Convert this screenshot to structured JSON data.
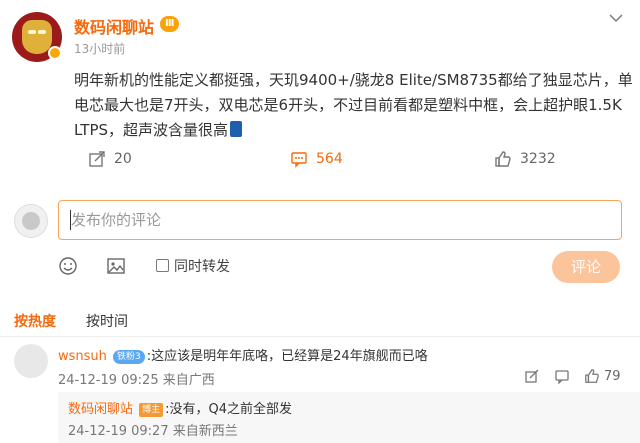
{
  "post": {
    "author": "数码闲聊站",
    "vip_badge": "Ⅲ",
    "time": "13小时前",
    "text": "明年新机的性能定义都挺强，天玑9400+/骁龙8 Elite/SM8735都给了独显芯片，单电芯最大也是7开头，双电芯是6开头，不过目前看都是塑料中框，会上超护眼1.5K LTPS，超声波含量很高",
    "reposts": "20",
    "comments": "564",
    "likes": "3232"
  },
  "composer": {
    "placeholder": "发布你的评论",
    "repost_label": "同时转发",
    "submit_label": "评论"
  },
  "tabs": {
    "hot": "按热度",
    "time": "按时间"
  },
  "comment": {
    "author": "wsnsuh",
    "level_badge": "铁粉3",
    "text": ":这应该是明年年底咯，已经算是24年旗舰而已咯",
    "time": "24-12-19 09:25 来自广西",
    "likes": "79"
  },
  "reply": {
    "author": "数码闲聊站",
    "badge": "博主",
    "text": ":没有，Q4之前全部发",
    "time": "24-12-19 09:27 来自新西兰"
  }
}
